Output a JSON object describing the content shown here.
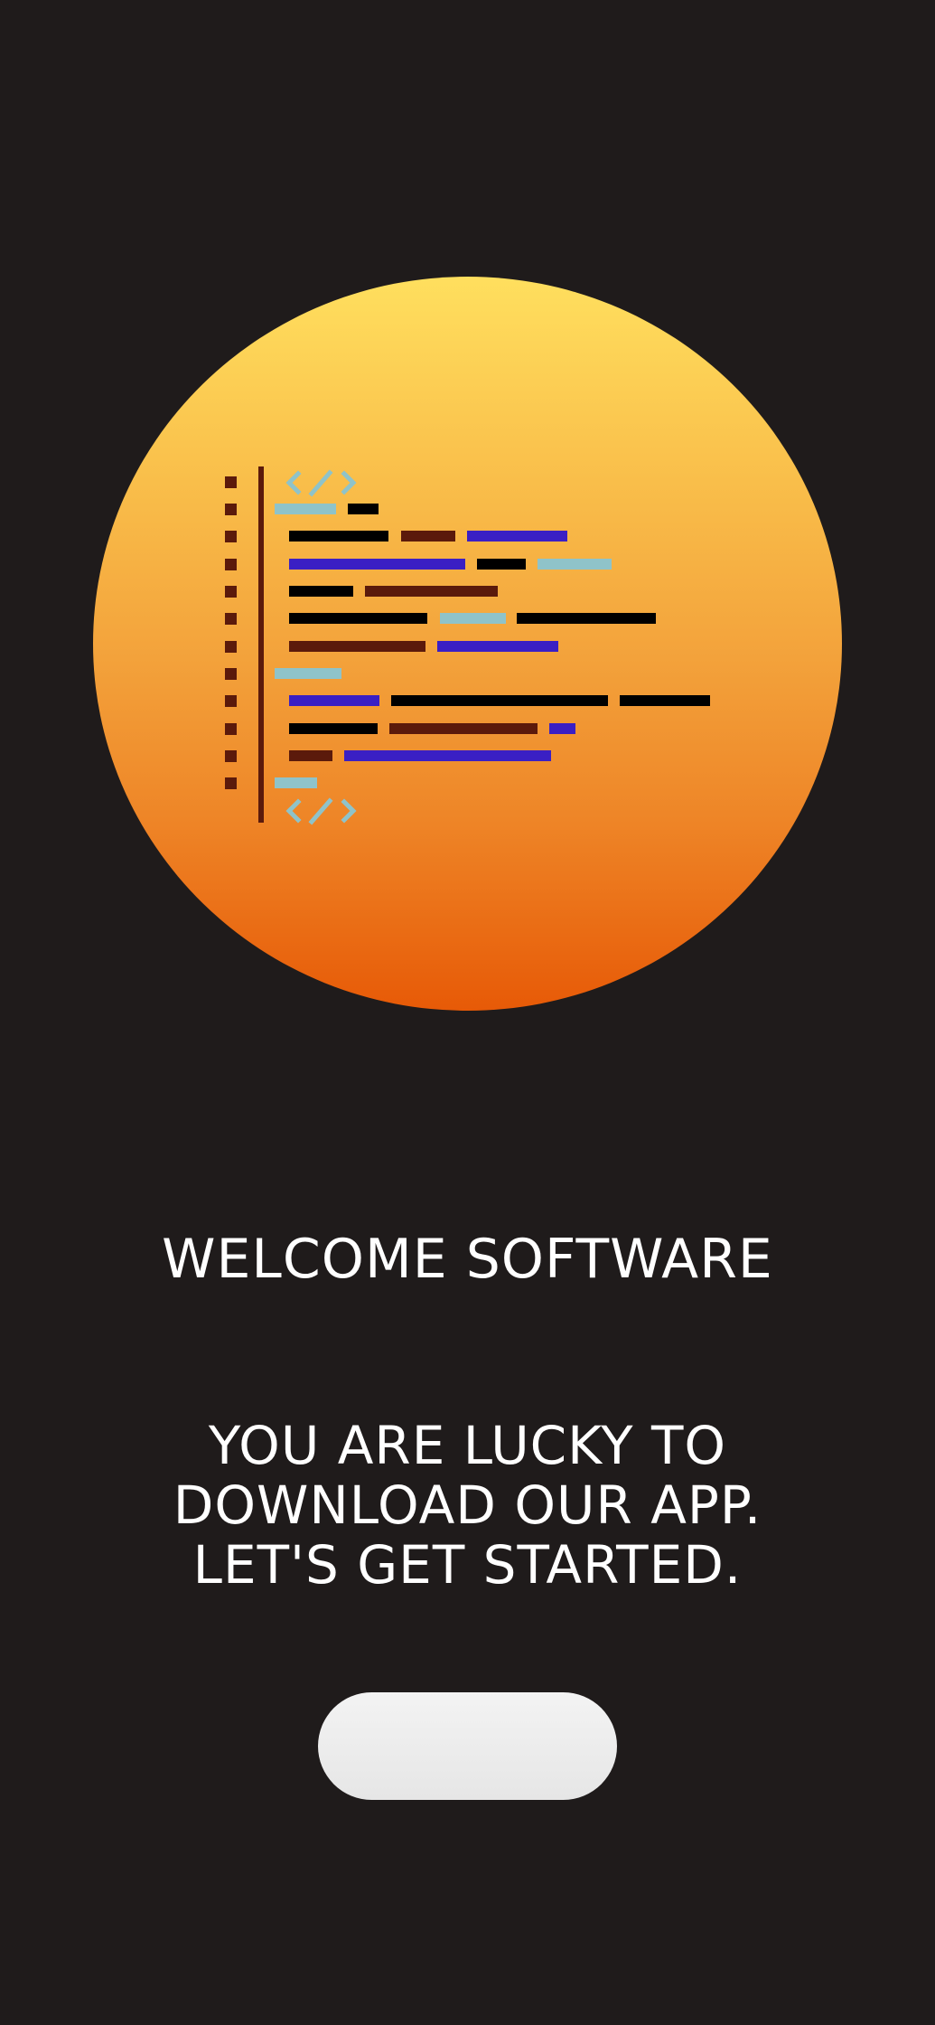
{
  "welcome": {
    "title": "WELCOME SOFTWARE",
    "tagline_lines": [
      "YOU ARE LUCKY TO",
      "DOWNLOAD OUR APP.",
      "LET'S GET STARTED."
    ]
  },
  "get_started_button": {
    "label": ""
  },
  "hero": {
    "icon": "code-editor-illustration",
    "gradient_top": "#ffdf5e",
    "gradient_bottom": "#e75a07"
  },
  "colors": {
    "background": "#1f1b1b",
    "text": "#ffffff",
    "button": "#ececec",
    "code_black": "#000000",
    "code_brown": "#5b1a0b",
    "code_blue": "#3a1fc4",
    "code_teal": "#8fc3c9"
  }
}
